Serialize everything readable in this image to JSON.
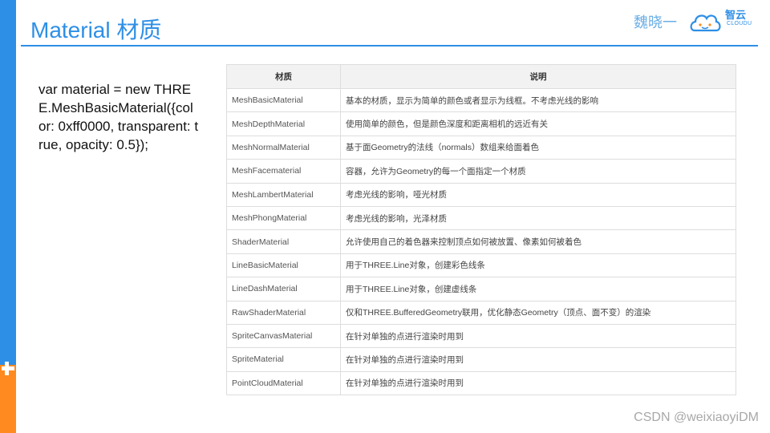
{
  "slide": {
    "title": "Material 材质",
    "author": "魏晓一",
    "logo_text": "智云",
    "logo_subtext": "CLOUDU"
  },
  "code": {
    "text": "var material = new THREE.MeshBasicMaterial({color: 0xff0000, transparent: true, opacity: 0.5});"
  },
  "table": {
    "headers": [
      "材质",
      "说明"
    ],
    "rows": [
      {
        "name": "MeshBasicMaterial",
        "desc": "基本的材质，显示为简单的颜色或者显示为线框。不考虑光线的影响"
      },
      {
        "name": "MeshDepthMaterial",
        "desc": "使用简单的颜色，但是颜色深度和距离相机的远近有关"
      },
      {
        "name": "MeshNormalMaterial",
        "desc": "基于面Geometry的法线（normals）数组来给面着色"
      },
      {
        "name": "MeshFacematerial",
        "desc": "容器，允许为Geometry的每一个面指定一个材质"
      },
      {
        "name": "MeshLambertMaterial",
        "desc": "考虑光线的影响，哑光材质"
      },
      {
        "name": "MeshPhongMaterial",
        "desc": "考虑光线的影响，光泽材质"
      },
      {
        "name": "ShaderMaterial",
        "desc": "允许使用自己的着色器来控制顶点如何被放置、像素如何被着色"
      },
      {
        "name": "LineBasicMaterial",
        "desc": "用于THREE.Line对象，创建彩色线条"
      },
      {
        "name": "LineDashMaterial",
        "desc": "用于THREE.Line对象，创建虚线条"
      },
      {
        "name": "RawShaderMaterial",
        "desc": "仅和THREE.BufferedGeometry联用，优化静态Geometry（顶点、面不变）的渲染"
      },
      {
        "name": "SpriteCanvasMaterial",
        "desc": "在针对单独的点进行渲染时用到"
      },
      {
        "name": "SpriteMaterial",
        "desc": "在针对单独的点进行渲染时用到"
      },
      {
        "name": "PointCloudMaterial",
        "desc": "在针对单独的点进行渲染时用到"
      }
    ]
  },
  "watermark": "CSDN @weixiaoyiDM",
  "colors": {
    "accent": "#2e8fe6",
    "orange": "#ff8a1f",
    "header_bg": "#f2f2f2",
    "border": "#dddddd"
  },
  "icons": [
    "cloud-logo-icon"
  ]
}
